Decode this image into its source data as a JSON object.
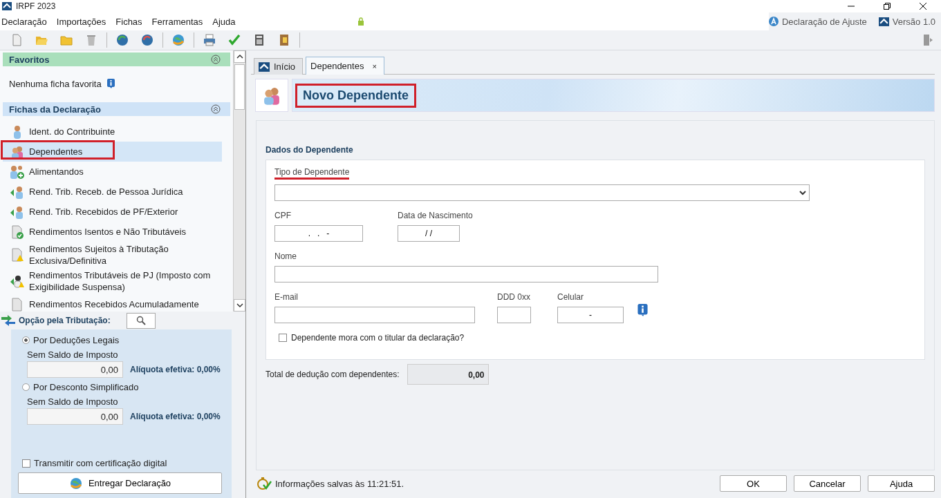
{
  "window": {
    "title": "IRPF 2023"
  },
  "menu": [
    "Declaração",
    "Importações",
    "Fichas",
    "Ferramentas",
    "Ajuda"
  ],
  "header_right": {
    "mode": "Declaração de Ajuste",
    "version": "Versão 1.0"
  },
  "favorites": {
    "title": "Favoritos",
    "empty_text": "Nenhuma ficha favorita"
  },
  "fichas": {
    "title": "Fichas da Declaração",
    "items": [
      {
        "label": "Ident. do Contribuinte",
        "kind": "person",
        "selected": false,
        "annotated": false
      },
      {
        "label": "Dependentes",
        "kind": "people",
        "selected": true,
        "annotated": true
      },
      {
        "label": "Alimentandos",
        "kind": "people-plus",
        "selected": false,
        "annotated": false
      },
      {
        "label": "Rend. Trib. Receb. de Pessoa Jurídica",
        "kind": "arrow-person",
        "selected": false,
        "annotated": false
      },
      {
        "label": "Rend. Trib. Recebidos de PF/Exterior",
        "kind": "arrow-person",
        "selected": false,
        "annotated": false
      },
      {
        "label": "Rendimentos Isentos e Não Tributáveis",
        "kind": "doc-check",
        "selected": false,
        "annotated": false
      },
      {
        "label": "Rendimentos Sujeitos à Tributação Exclusiva/Definitiva",
        "kind": "doc-warning",
        "selected": false,
        "annotated": false
      },
      {
        "label": "Rendimentos Tributáveis de PJ (Imposto com Exigibilidade Suspensa)",
        "kind": "arrow-warning",
        "selected": false,
        "annotated": false
      },
      {
        "label": "Rendimentos Recebidos Acumuladamente",
        "kind": "doc",
        "selected": false,
        "annotated": false
      }
    ]
  },
  "tributacao": {
    "title": "Opção pela Tributação:",
    "options": [
      {
        "label": "Por Deduções Legais",
        "selected": true,
        "sublabel": "Sem Saldo de Imposto",
        "value": "0,00",
        "rate": "Alíquota efetiva: 0,00%"
      },
      {
        "label": "Por Desconto Simplificado",
        "selected": false,
        "sublabel": "Sem Saldo de Imposto",
        "value": "0,00",
        "rate": "Alíquota efetiva: 0,00%"
      }
    ],
    "certificate": {
      "label": "Transmitir com certificação digital",
      "checked": false
    },
    "submit": "Entregar Declaração"
  },
  "tabs": [
    {
      "label": "Início",
      "selected": false
    },
    {
      "label": "Dependentes",
      "selected": true,
      "close": "×"
    }
  ],
  "page": {
    "title": "Novo Dependente",
    "annotated": true
  },
  "form": {
    "section": "Dados do Dependente",
    "rows": [
      [
        {
          "label": "Tipo de Dependente",
          "kind": "select",
          "underlined": true
        }
      ],
      [
        {
          "label": "CPF",
          "kind": "text",
          "value": ".   .   -"
        },
        {
          "label": "Data de Nascimento",
          "kind": "text",
          "value": "/ /"
        }
      ],
      [
        {
          "label": "Nome",
          "kind": "text"
        }
      ],
      [
        {
          "label": "E-mail",
          "kind": "text"
        },
        {
          "label": "DDD 0xx",
          "kind": "text"
        },
        {
          "label": "Celular",
          "kind": "text",
          "value": "-",
          "info": true
        }
      ]
    ],
    "checkbox": {
      "label": "Dependente mora com o titular da declaração?",
      "checked": false
    }
  },
  "total": {
    "label": "Total de dedução com dependentes:",
    "value": "0,00"
  },
  "status": "Informações salvas às 11:21:51.",
  "buttons": [
    "OK",
    "Cancelar",
    "Ajuda"
  ]
}
